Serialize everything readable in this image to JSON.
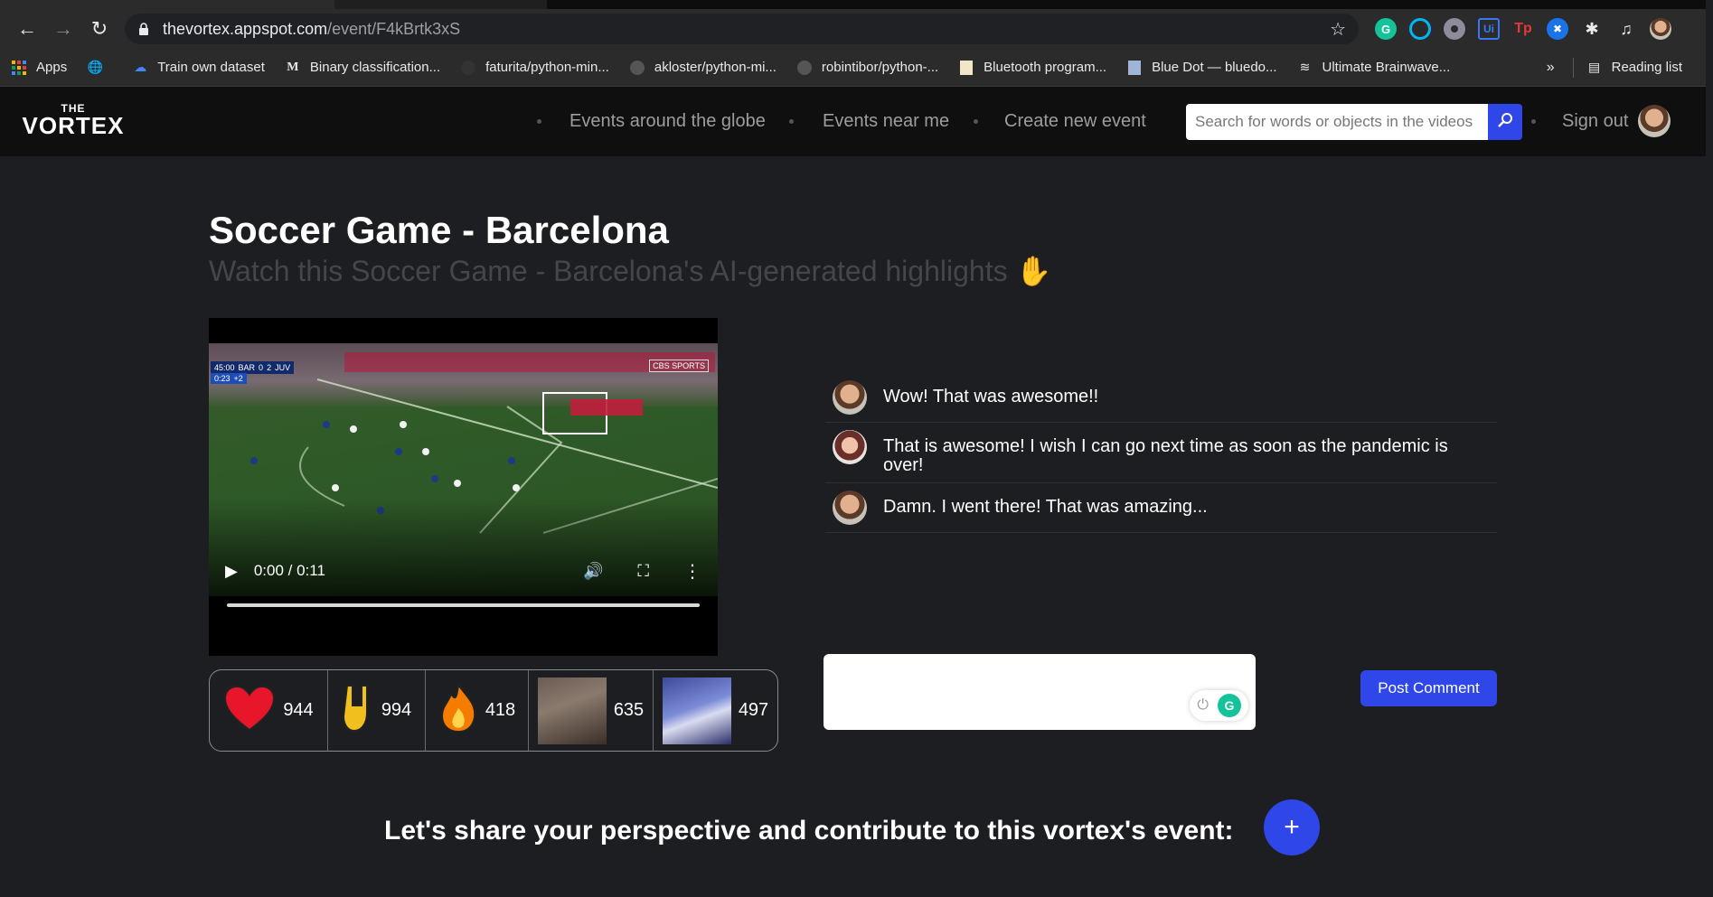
{
  "browser": {
    "url_host": "thevortex.appspot.com",
    "url_path": "/event/F4kBrtk3xS",
    "bookmarks": [
      {
        "label": "Apps",
        "icon": "apps-grid-icon"
      },
      {
        "label": "",
        "icon": "globe-icon"
      },
      {
        "label": "Train own dataset",
        "icon": "google-cloud-icon"
      },
      {
        "label": "Binary classification...",
        "icon": "medium-icon"
      },
      {
        "label": "faturita/python-min...",
        "icon": "github-icon"
      },
      {
        "label": "akloster/python-mi...",
        "icon": "github-icon"
      },
      {
        "label": "robintibor/python-...",
        "icon": "github-icon"
      },
      {
        "label": "Bluetooth program...",
        "icon": "bookmark-page-icon"
      },
      {
        "label": "Blue Dot — bluedo...",
        "icon": "doc-icon"
      },
      {
        "label": "Ultimate Brainwave...",
        "icon": "brainwave-icon"
      }
    ],
    "more_label": "»",
    "reading_list": "Reading list"
  },
  "site": {
    "logo_top": "THE",
    "logo_bottom": "VORTEX",
    "nav": {
      "globe": "Events around the globe",
      "near": "Events near me",
      "create": "Create new event",
      "signout": "Sign out"
    },
    "search_placeholder": "Search for words or objects in the videos"
  },
  "event": {
    "title": "Soccer Game - Barcelona",
    "subtitle": "Watch this Soccer Game - Barcelona's AI-generated highlights",
    "video_time": "0:00 / 0:11",
    "scoreboard": {
      "clock": "45:00",
      "home": "BAR",
      "home_score": "0",
      "away_score": "2",
      "away": "JUV",
      "added": "+2",
      "elapsed": "0:23"
    },
    "broadcaster": "CBS SPORTS"
  },
  "reactions": [
    {
      "name": "heart",
      "count": "944"
    },
    {
      "name": "rock-on",
      "count": "994"
    },
    {
      "name": "fire",
      "count": "418"
    },
    {
      "name": "gif-dance",
      "count": "635"
    },
    {
      "name": "gif-celebrate",
      "count": "497"
    }
  ],
  "comments": [
    {
      "text": "Wow! That was awesome!!",
      "avatar": "male"
    },
    {
      "text": "That is awesome! I wish I can go next time as soon as the pandemic is over!",
      "avatar": "female"
    },
    {
      "text": "Damn. I went there! That was amazing...",
      "avatar": "male"
    }
  ],
  "comment_form": {
    "post_label": "Post Comment"
  },
  "contribute": {
    "text": "Let's share your perspective and contribute to this vortex's event:",
    "button": "+"
  },
  "colors": {
    "accent": "#2f46e8",
    "background": "#1d1e22",
    "header": "#0f0f10",
    "subtitle": "#45464b"
  }
}
